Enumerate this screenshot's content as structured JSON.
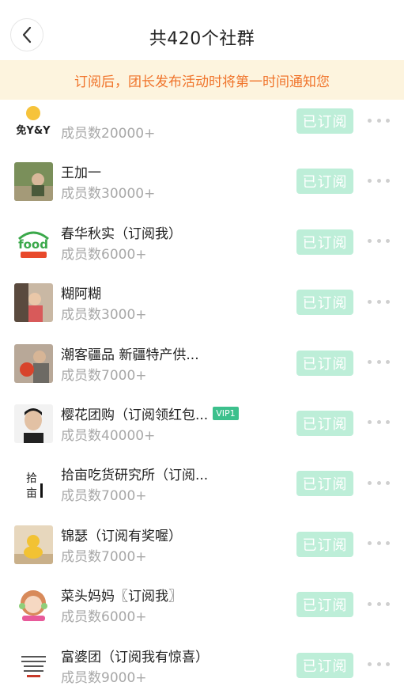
{
  "header": {
    "title": "共420个社群"
  },
  "banner": {
    "text": "订阅后，团长发布活动时将第一时间通知您"
  },
  "subscribed_label": "已订阅",
  "colors": {
    "accent_green": "#3cc08c",
    "subscribed_button": "#bdeed8",
    "banner_text": "#f0742b",
    "banner_bg": "#fdf4de"
  },
  "groups": [
    {
      "name": "",
      "members": "成员数20000+",
      "avatar_text": "",
      "vip": ""
    },
    {
      "name": "王加一",
      "members": "成员数30000+",
      "avatar_text": "",
      "vip": ""
    },
    {
      "name": "春华秋实（订阅我）",
      "members": "成员数6000+",
      "avatar_text": "food",
      "vip": ""
    },
    {
      "name": "糊阿糊",
      "members": "成员数3000+",
      "avatar_text": "",
      "vip": ""
    },
    {
      "name": "潮客疆品 新疆特产供...",
      "members": "成员数7000+",
      "avatar_text": "",
      "vip": ""
    },
    {
      "name": "樱花团购（订阅领红包...",
      "members": "成员数40000+",
      "avatar_text": "",
      "vip": "VIP1"
    },
    {
      "name": "拾亩吃货研究所（订阅...",
      "members": "成员数7000+",
      "avatar_text": "拾亩",
      "vip": ""
    },
    {
      "name": "锦瑟（订阅有奖喔）",
      "members": "成员数7000+",
      "avatar_text": "",
      "vip": ""
    },
    {
      "name": "菜头妈妈〖订阅我〗",
      "members": "成员数6000+",
      "avatar_text": "",
      "vip": ""
    },
    {
      "name": "富婆团（订阅我有惊喜）",
      "members": "成员数9000+",
      "avatar_text": "",
      "vip": ""
    }
  ]
}
